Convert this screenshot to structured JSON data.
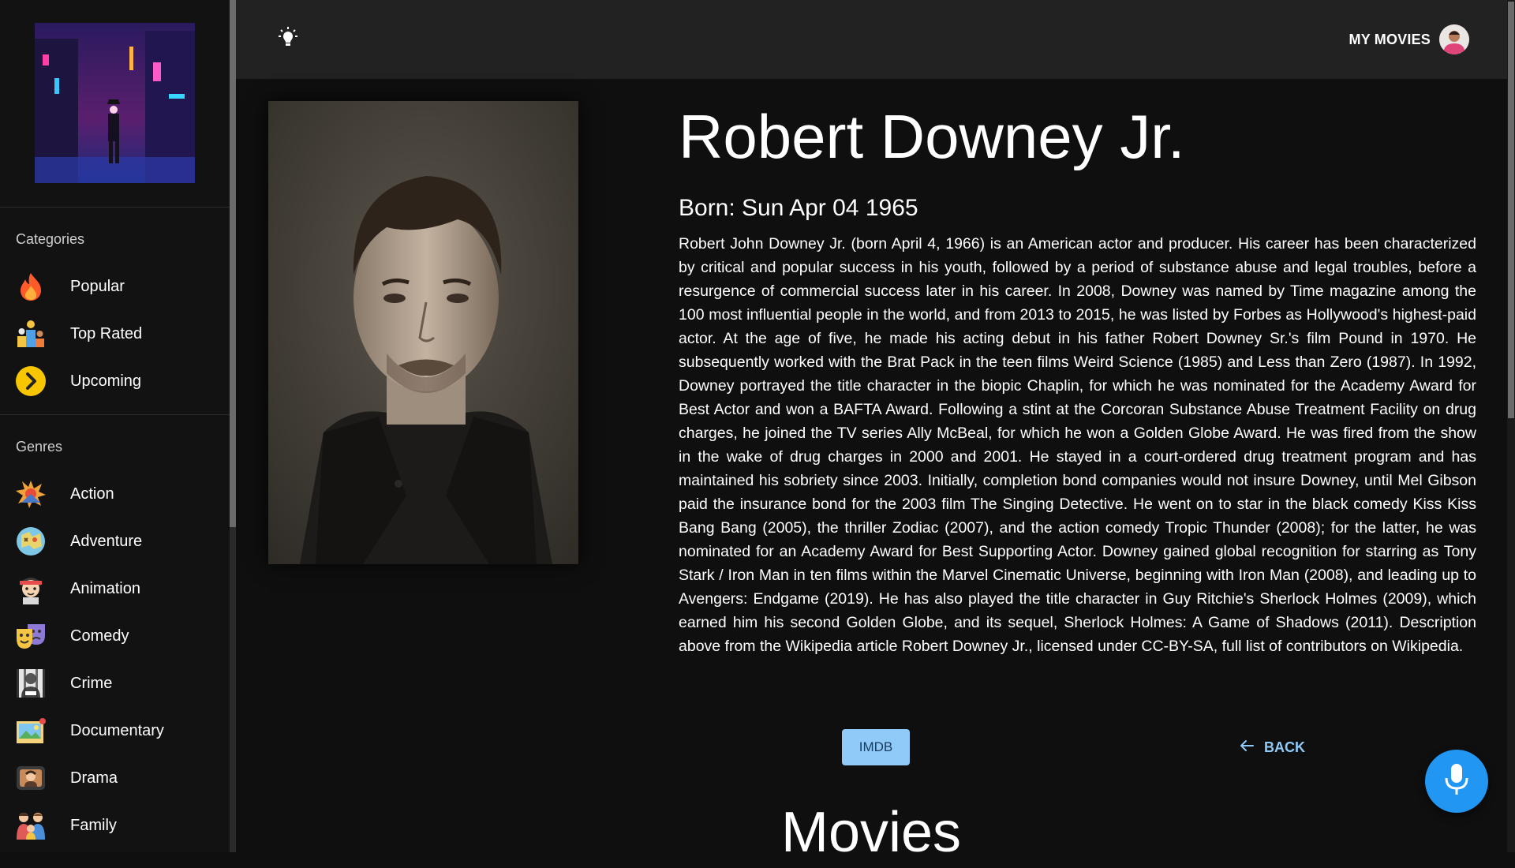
{
  "sidebar": {
    "categories_title": "Categories",
    "categories": [
      {
        "label": "Popular",
        "icon": "fire-icon"
      },
      {
        "label": "Top Rated",
        "icon": "podium-icon"
      },
      {
        "label": "Upcoming",
        "icon": "chevron-right-circle-icon"
      }
    ],
    "genres_title": "Genres",
    "genres": [
      {
        "label": "Action",
        "icon": "explosion-icon"
      },
      {
        "label": "Adventure",
        "icon": "map-icon"
      },
      {
        "label": "Animation",
        "icon": "cartoon-face-icon"
      },
      {
        "label": "Comedy",
        "icon": "theater-masks-icon"
      },
      {
        "label": "Crime",
        "icon": "prisoner-icon"
      },
      {
        "label": "Documentary",
        "icon": "picture-icon"
      },
      {
        "label": "Drama",
        "icon": "drama-tv-icon"
      },
      {
        "label": "Family",
        "icon": "family-icon"
      }
    ]
  },
  "header": {
    "theme_toggle_icon": "lightbulb-icon",
    "my_movies_label": "MY MOVIES"
  },
  "actor": {
    "name": "Robert Downey Jr.",
    "born": "Born: Sun Apr 04 1965",
    "biography": "Robert John Downey Jr. (born April 4, 1966) is an American actor and producer. His career has been characterized by critical and popular success in his youth, followed by a period of substance abuse and legal troubles, before a resurgence of commercial success later in his career. In 2008, Downey was named by Time magazine among the 100 most influential people in the world, and from 2013 to 2015, he was listed by Forbes as Hollywood's highest-paid actor. At the age of five, he made his acting debut in his father Robert Downey Sr.'s film Pound in 1970. He subsequently worked with the Brat Pack in the teen films Weird Science (1985) and Less than Zero (1987). In 1992, Downey portrayed the title character in the biopic Chaplin, for which he was nominated for the Academy Award for Best Actor and won a BAFTA Award. Following a stint at the Corcoran Substance Abuse Treatment Facility on drug charges, he joined the TV series Ally McBeal, for which he won a Golden Globe Award. He was fired from the show in the wake of drug charges in 2000 and 2001. He stayed in a court-ordered drug treatment program and has maintained his sobriety since 2003. Initially, completion bond companies would not insure Downey, until Mel Gibson paid the insurance bond for the 2003 film The Singing Detective. He went on to star in the black comedy Kiss Kiss Bang Bang (2005), the thriller Zodiac (2007), and the action comedy Tropic Thunder (2008); for the latter, he was nominated for an Academy Award for Best Supporting Actor. Downey gained global recognition for starring as Tony Stark / Iron Man in ten films within the Marvel Cinematic Universe, beginning with Iron Man (2008), and leading up to Avengers: Endgame (2019). He has also played the title character in Guy Ritchie's Sherlock Holmes (2009), which earned him his second Golden Globe, and its sequel, Sherlock Holmes: A Game of Shadows (2011). Description above from the Wikipedia article Robert Downey Jr., licensed under CC-BY-SA, full list of contributors on Wikipedia."
  },
  "actions": {
    "imdb_label": "IMDB",
    "back_label": "BACK"
  },
  "movies_section_title": "Movies",
  "colors": {
    "accent": "#90caf9",
    "fab": "#2196f3",
    "header_bg": "#222222",
    "sidebar_bg": "#121212",
    "page_bg": "#0f0f0f"
  }
}
